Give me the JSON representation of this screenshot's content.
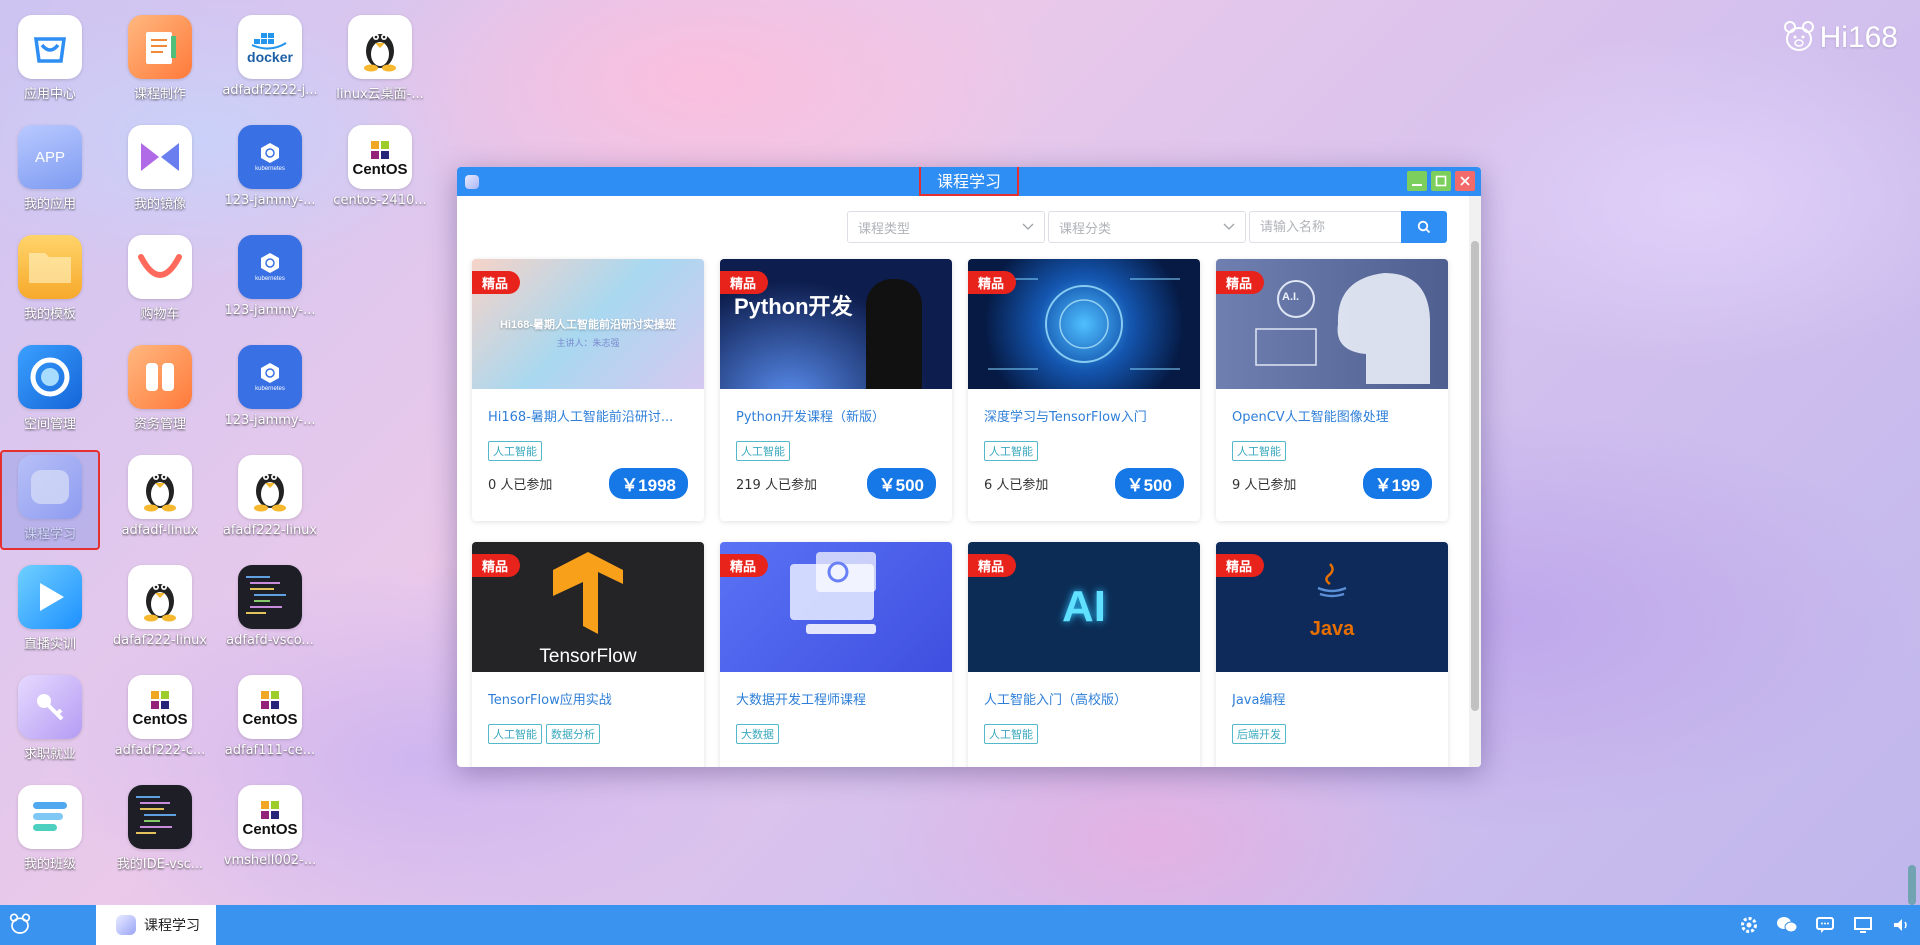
{
  "desktop": {
    "logo_text": "Hi168",
    "icons": [
      {
        "label": "应用中心",
        "icon": "app-store-icon"
      },
      {
        "label": "课程制作",
        "icon": "notebook-icon"
      },
      {
        "label": "adfadf2222-j...",
        "icon": "docker-icon",
        "docker_text": "docker"
      },
      {
        "label": "linux云桌面-...",
        "icon": "linux-penguin-icon"
      },
      {
        "label": "我的应用",
        "icon": "app-icon",
        "tile_text": "APP"
      },
      {
        "label": "我的镜像",
        "icon": "mirror-image-icon"
      },
      {
        "label": "123-jammy-...",
        "icon": "kubernetes-icon",
        "tile_text": "kubernetes"
      },
      {
        "label": "centos-2410...",
        "icon": "centos-icon",
        "tile_text": "CentOS"
      },
      {
        "label": "我的模板",
        "icon": "folder-icon"
      },
      {
        "label": "购物车",
        "icon": "shopping-cart-icon"
      },
      {
        "label": "123-jammy-...",
        "icon": "kubernetes-icon",
        "tile_text": "kubernetes"
      },
      {
        "label": "空间管理",
        "icon": "space-manage-icon"
      },
      {
        "label": "资务管理",
        "icon": "pause-manage-icon"
      },
      {
        "label": "123-jammy-...",
        "icon": "kubernetes-icon",
        "tile_text": "kubernetes"
      },
      {
        "label": "课程学习",
        "icon": "course-study-icon"
      },
      {
        "label": "adfadf-linux",
        "icon": "linux-penguin-icon"
      },
      {
        "label": "afadf222-linux",
        "icon": "linux-penguin-icon"
      },
      {
        "label": "直播实训",
        "icon": "play-icon"
      },
      {
        "label": "dafaf222-linux",
        "icon": "linux-penguin-icon"
      },
      {
        "label": "adfafd-vsco...",
        "icon": "vscode-icon"
      },
      {
        "label": "求职就业",
        "icon": "job-key-icon"
      },
      {
        "label": "adfadf222-c...",
        "icon": "centos-icon",
        "tile_text": "CentOS"
      },
      {
        "label": "adfaf111-ce...",
        "icon": "centos-icon",
        "tile_text": "CentOS"
      },
      {
        "label": "我的班级",
        "icon": "class-list-icon"
      },
      {
        "label": "我的IDE-vsc...",
        "icon": "vscode-icon"
      },
      {
        "label": "vmshell002-...",
        "icon": "centos-icon",
        "tile_text": "CentOS"
      }
    ]
  },
  "window": {
    "title": "课程学习",
    "filters": {
      "type_placeholder": "课程类型",
      "category_placeholder": "课程分类",
      "search_placeholder": "请输入名称"
    },
    "badge": "精品",
    "courses": [
      {
        "title": "Hi168-暑期人工智能前沿研讨...",
        "tags": [
          "人工智能"
        ],
        "joined": "0 人已参加",
        "price": "￥1998",
        "thumb_text": "Hi168-暑期人工智能前沿研讨实操班",
        "thumb_sub": "主讲人：朱志强",
        "color": "#9fd2ee"
      },
      {
        "title": "Python开发课程（新版）",
        "tags": [
          "人工智能"
        ],
        "joined": "219 人已参加",
        "price": "￥500",
        "thumb_text": "Python开发",
        "color": "#0d1d4d"
      },
      {
        "title": "深度学习与TensorFlow入门",
        "tags": [
          "人工智能"
        ],
        "joined": "6 人已参加",
        "price": "￥500",
        "color": "#0a2a66"
      },
      {
        "title": "OpenCV人工智能图像处理",
        "tags": [
          "人工智能"
        ],
        "joined": "9 人已参加",
        "price": "￥199",
        "thumb_text": "A.I.",
        "color": "#5a6fa0"
      },
      {
        "title": "TensorFlow应用实战",
        "tags": [
          "人工智能",
          "数据分析"
        ],
        "joined": "",
        "price": "",
        "thumb_text": "TensorFlow",
        "color": "#2a2a2c"
      },
      {
        "title": "大数据开发工程师课程",
        "tags": [
          "大数据"
        ],
        "joined": "",
        "price": "",
        "color": "#4b64ef"
      },
      {
        "title": "人工智能入门（高校版）",
        "tags": [
          "人工智能"
        ],
        "joined": "",
        "price": "",
        "thumb_text": "AI",
        "color": "#0c2c55"
      },
      {
        "title": "Java编程",
        "tags": [
          "后端开发"
        ],
        "joined": "",
        "price": "",
        "thumb_text": "Java",
        "color": "#0e2a5a"
      }
    ]
  },
  "taskbar": {
    "active_task": "课程学习"
  }
}
